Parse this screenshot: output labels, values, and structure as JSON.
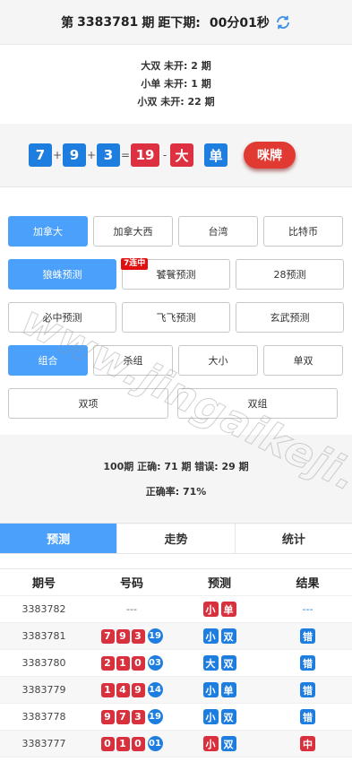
{
  "header": {
    "period_prefix": "第",
    "period_number": "3383781",
    "period_suffix": "期",
    "countdown_label": "距下期:",
    "countdown_value": "00分01秒",
    "refresh_icon": "refresh-icon"
  },
  "missing": [
    "大双 未开: 2 期",
    "小单 未开: 1 期",
    "小双 未开: 22 期"
  ],
  "result": {
    "n1": "7",
    "op1": "+",
    "n2": "9",
    "op2": "+",
    "n3": "3",
    "eq": "=",
    "sum": "19",
    "dash": "-",
    "size": "大",
    "parity": "单",
    "mipai_label": "咪牌"
  },
  "regions": [
    "加拿大",
    "加拿大西",
    "台湾",
    "比特币"
  ],
  "predict_methods": [
    "狼蛛预测",
    "饕餮预测",
    "28预测",
    "必中预测",
    "飞飞预测",
    "玄武预测"
  ],
  "predict_badge": "7连中",
  "bet_types": [
    "组合",
    "杀组",
    "大小",
    "单双",
    "双项",
    "双组"
  ],
  "stats": {
    "line1": "100期 正确: 71 期 错误: 29 期",
    "line2": "正确率: 71%"
  },
  "tabs": [
    "预测",
    "走势",
    "统计"
  ],
  "table": {
    "headers": [
      "期号",
      "号码",
      "预测",
      "结果"
    ],
    "rows": [
      {
        "period": "3383782",
        "n": [
          "---"
        ],
        "sum": "",
        "pred": [
          "小",
          "单"
        ],
        "pred_colors": [
          "red",
          "red"
        ],
        "result": "---",
        "result_color": "blue"
      },
      {
        "period": "3383781",
        "n": [
          "7",
          "9",
          "3"
        ],
        "sum": "19",
        "pred": [
          "小",
          "双"
        ],
        "pred_colors": [
          "blue",
          "blue"
        ],
        "result": "错",
        "result_color": "blue"
      },
      {
        "period": "3383780",
        "n": [
          "2",
          "1",
          "0"
        ],
        "sum": "03",
        "pred": [
          "大",
          "双"
        ],
        "pred_colors": [
          "blue",
          "blue"
        ],
        "result": "错",
        "result_color": "blue"
      },
      {
        "period": "3383779",
        "n": [
          "1",
          "4",
          "9"
        ],
        "sum": "14",
        "pred": [
          "小",
          "单"
        ],
        "pred_colors": [
          "blue",
          "blue"
        ],
        "result": "错",
        "result_color": "blue"
      },
      {
        "period": "3383778",
        "n": [
          "9",
          "7",
          "3"
        ],
        "sum": "19",
        "pred": [
          "小",
          "双"
        ],
        "pred_colors": [
          "blue",
          "blue"
        ],
        "result": "错",
        "result_color": "blue"
      },
      {
        "period": "3383777",
        "n": [
          "0",
          "1",
          "0"
        ],
        "sum": "01",
        "pred": [
          "小",
          "双"
        ],
        "pred_colors": [
          "red",
          "blue"
        ],
        "result": "中",
        "result_color": "red"
      }
    ]
  },
  "watermark": "www.jingaikeji.com",
  "colors": {
    "accent": "#4aa0fa",
    "red": "#d8303c",
    "blue": "#1e7ee0"
  }
}
